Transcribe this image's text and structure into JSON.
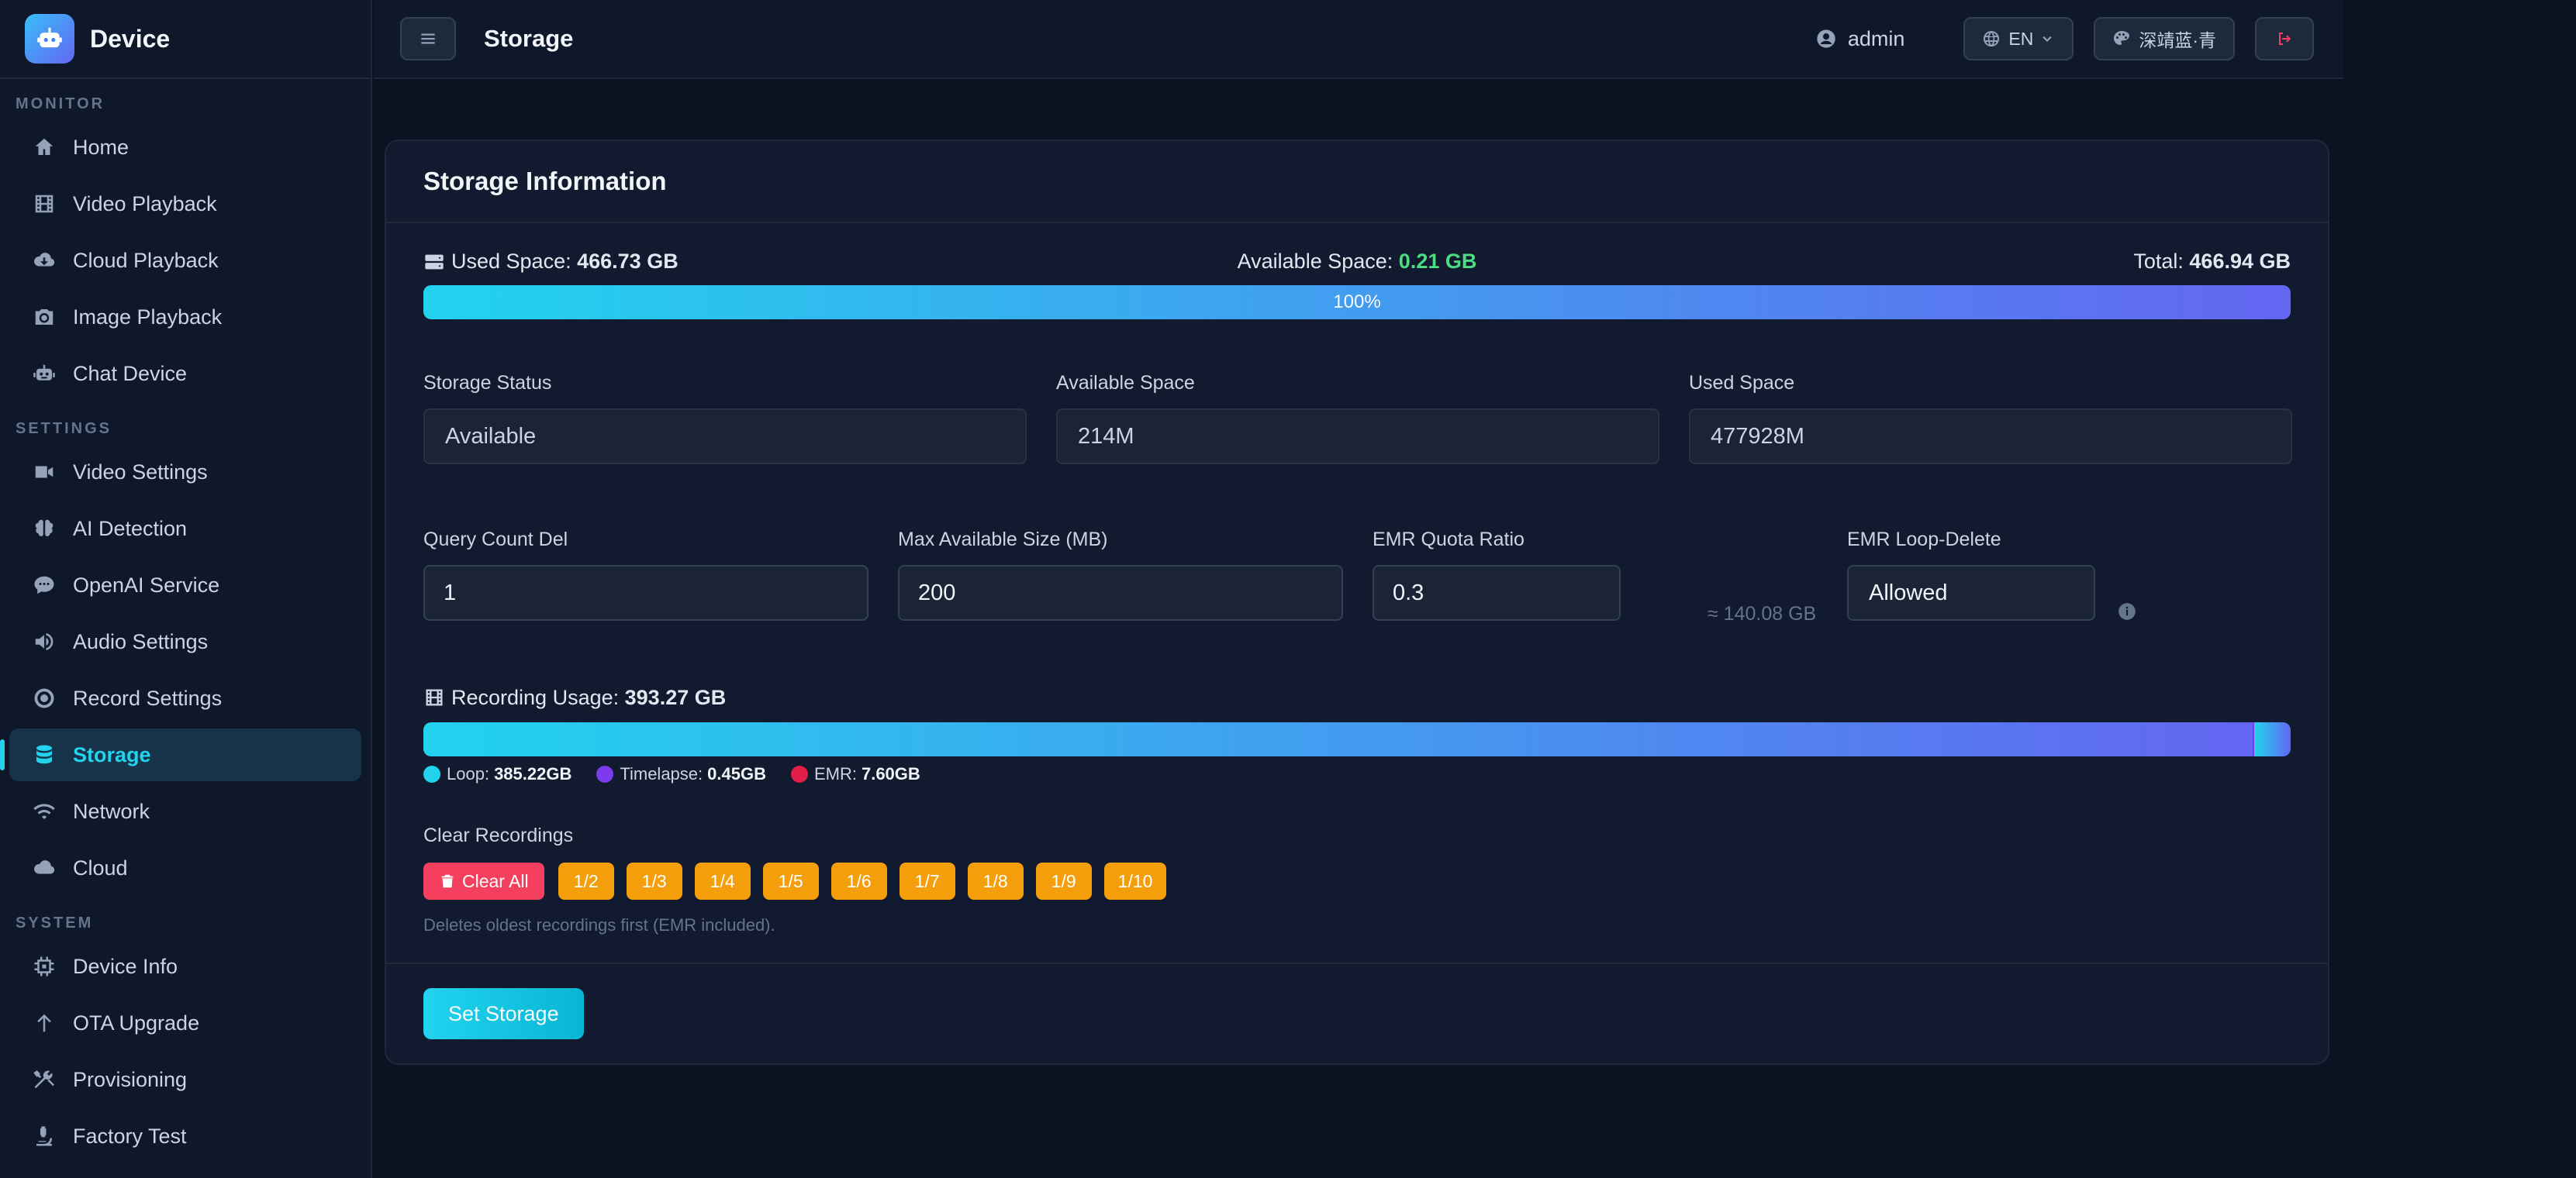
{
  "brand": {
    "name": "Device"
  },
  "sidebar": {
    "sections": [
      {
        "title": "MONITOR",
        "items": [
          {
            "label": "Home",
            "icon": "home-icon"
          },
          {
            "label": "Video Playback",
            "icon": "film-icon"
          },
          {
            "label": "Cloud Playback",
            "icon": "cloud-download-icon"
          },
          {
            "label": "Image Playback",
            "icon": "camera-icon"
          },
          {
            "label": "Chat Device",
            "icon": "robot-icon"
          }
        ]
      },
      {
        "title": "SETTINGS",
        "items": [
          {
            "label": "Video Settings",
            "icon": "video-camera-icon"
          },
          {
            "label": "AI Detection",
            "icon": "brain-icon"
          },
          {
            "label": "OpenAI Service",
            "icon": "chat-icon"
          },
          {
            "label": "Audio Settings",
            "icon": "speaker-icon"
          },
          {
            "label": "Record Settings",
            "icon": "record-icon"
          },
          {
            "label": "Storage",
            "icon": "database-icon",
            "active": true
          },
          {
            "label": "Network",
            "icon": "wifi-icon"
          },
          {
            "label": "Cloud",
            "icon": "cloud-icon"
          }
        ]
      },
      {
        "title": "SYSTEM",
        "items": [
          {
            "label": "Device Info",
            "icon": "chip-icon"
          },
          {
            "label": "OTA Upgrade",
            "icon": "arrow-up-icon"
          },
          {
            "label": "Provisioning",
            "icon": "tools-icon"
          },
          {
            "label": "Factory Test",
            "icon": "microscope-icon"
          }
        ]
      }
    ]
  },
  "header": {
    "title": "Storage",
    "user": "admin",
    "language": "EN",
    "theme": "深靖蓝·青"
  },
  "card": {
    "title": "Storage Information",
    "used_space_label": "Used Space:",
    "used_space_value": "466.73 GB",
    "available_space_label": "Available Space:",
    "available_space_value": "0.21 GB",
    "total_label": "Total:",
    "total_value": "466.94 GB",
    "usage_percent": 100,
    "usage_percent_text": "100%",
    "fields_row1": {
      "storage_status_label": "Storage Status",
      "storage_status_value": "Available",
      "available_space_label": "Available Space",
      "available_space_value": "214M",
      "used_space_label": "Used Space",
      "used_space_value": "477928M"
    },
    "fields_row2": {
      "query_count_label": "Query Count Del",
      "query_count_value": "1",
      "max_size_label": "Max Available Size (MB)",
      "max_size_value": "200",
      "emr_quota_label": "EMR Quota Ratio",
      "emr_quota_value": "0.3",
      "emr_quota_hint": "≈ 140.08 GB",
      "emr_loop_label": "EMR Loop-Delete",
      "emr_loop_value": "Allowed"
    },
    "recording": {
      "title": "Recording Usage:",
      "total": "393.27 GB",
      "segments": [
        {
          "name": "Loop:",
          "value": "385.22GB",
          "color": "#22d3ee",
          "gb": 385.22
        },
        {
          "name": "Timelapse:",
          "value": "0.45GB",
          "color": "#7c3aed",
          "gb": 0.45
        },
        {
          "name": "EMR:",
          "value": "7.60GB",
          "color": "#e11d48",
          "gb": 7.6
        }
      ]
    },
    "clear": {
      "label": "Clear Recordings",
      "clear_all": "Clear All",
      "fractions": [
        "1/2",
        "1/3",
        "1/4",
        "1/5",
        "1/6",
        "1/7",
        "1/8",
        "1/9",
        "1/10"
      ],
      "note": "Deletes oldest recordings first (EMR included)."
    },
    "submit_label": "Set Storage"
  }
}
